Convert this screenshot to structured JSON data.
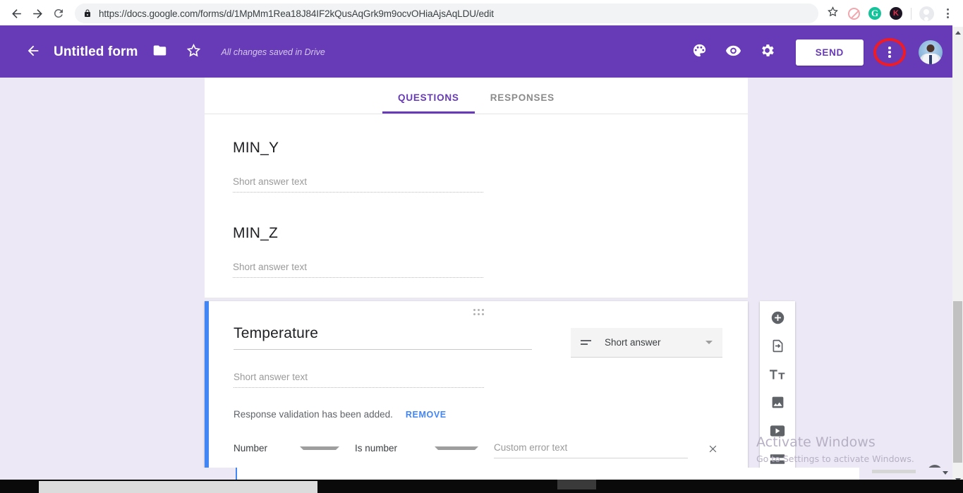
{
  "browser": {
    "url_scheme": "https://",
    "url_domain": "docs.google.com",
    "url_path": "/forms/d/1MpMm1Rea18J84IF2kQusAqGrk9m9ocvOHiaAjsAqLDU/edit",
    "url_full": "https://docs.google.com/forms/d/1MpMm1Rea18J84IF2kQusAqGrk9m9ocvOHiaAjsAqLDU/edit",
    "back_icon": "back-arrow-icon",
    "forward_icon": "forward-arrow-icon",
    "reload_icon": "reload-icon",
    "lock_icon": "lock-icon",
    "bookmark_icon": "star-icon",
    "extensions": [
      {
        "name": "adblock-extension-icon",
        "label": ""
      },
      {
        "name": "grammarly-extension-icon",
        "label": "G",
        "color": "#15c39a"
      },
      {
        "name": "kami-extension-icon",
        "label": "K",
        "color": "#e0314b"
      }
    ],
    "profile_icon": "profile-avatar-icon",
    "menu_icon": "chrome-menu-icon"
  },
  "forms_header": {
    "back_icon": "back-arrow-icon",
    "title": "Untitled form",
    "folder_icon": "folder-icon",
    "star_icon": "star-outline-icon",
    "save_status": "All changes saved in Drive",
    "palette_icon": "palette-icon",
    "preview_icon": "eye-preview-icon",
    "settings_icon": "gear-settings-icon",
    "send_label": "SEND",
    "more_icon": "more-options-vertical-icon",
    "more_highlight_color": "#ef1b25",
    "avatar": "user-avatar",
    "bg_color": "#673ab7"
  },
  "tabs": [
    {
      "label": "QUESTIONS",
      "active": true
    },
    {
      "label": "RESPONSES",
      "active": false
    }
  ],
  "questions": [
    {
      "title": "MIN_Y",
      "answer_placeholder": "Short answer text"
    },
    {
      "title": "MIN_Z",
      "answer_placeholder": "Short answer text"
    }
  ],
  "active_question": {
    "drag_handle_icon": "drag-handle-icon",
    "title": "Temperature",
    "answer_placeholder": "Short answer text",
    "type_icon": "short-answer-icon",
    "type_value": "Short answer",
    "type_caret_icon": "chevron-down-icon",
    "validation_text": "Response validation has been added.",
    "validation_remove_label": "REMOVE",
    "validation_remove_color": "#4285f4",
    "rule_type": "Number",
    "rule_condition": "Is number",
    "error_placeholder": "Custom error text",
    "close_icon": "close-x-icon",
    "accent_color": "#4285f4"
  },
  "side_toolbar": [
    {
      "name": "add-question-button",
      "icon": "plus-circle-icon"
    },
    {
      "name": "import-questions-button",
      "icon": "import-document-icon"
    },
    {
      "name": "add-title-description-button",
      "icon": "title-text-icon"
    },
    {
      "name": "add-image-button",
      "icon": "image-icon"
    },
    {
      "name": "add-video-button",
      "icon": "video-play-icon"
    },
    {
      "name": "add-section-button",
      "icon": "section-divider-icon"
    }
  ],
  "watermark": {
    "line1": "Activate Windows",
    "line2": "Go to Settings to activate Windows."
  },
  "help_button": {
    "label": "?"
  },
  "scroll": {
    "vertical_icon_up": "scroll-up-arrow",
    "vertical_icon_down": "scroll-down-arrow"
  }
}
